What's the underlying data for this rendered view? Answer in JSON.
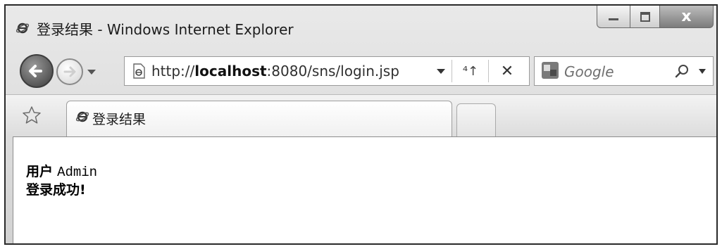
{
  "window": {
    "title": "登录结果 - Windows Internet Explorer",
    "buttons": {
      "minimize": "minimize",
      "maximize": "maximize",
      "close": "x"
    }
  },
  "nav": {
    "url_prefix": "http://",
    "url_host": "localhost",
    "url_suffix": ":8080/sns/login.jsp",
    "refresh_glyph": "⁴↑",
    "stop_glyph": "✕",
    "search_placeholder": "Google"
  },
  "tabs": [
    {
      "label": "登录结果",
      "active": true
    }
  ],
  "page": {
    "user_label": "用户",
    "username": "Admin",
    "message": "登录成功!"
  },
  "icons": {
    "ie": "ie-logo-icon",
    "back": "back-arrow-icon",
    "forward": "forward-arrow-icon",
    "page": "page-icon",
    "search": "magnifier-icon",
    "favorites": "star-icon"
  },
  "colors": {
    "frame": "#2a2a2a",
    "chrome": "#d9d9d9",
    "close_button": "#8c8c8c"
  }
}
